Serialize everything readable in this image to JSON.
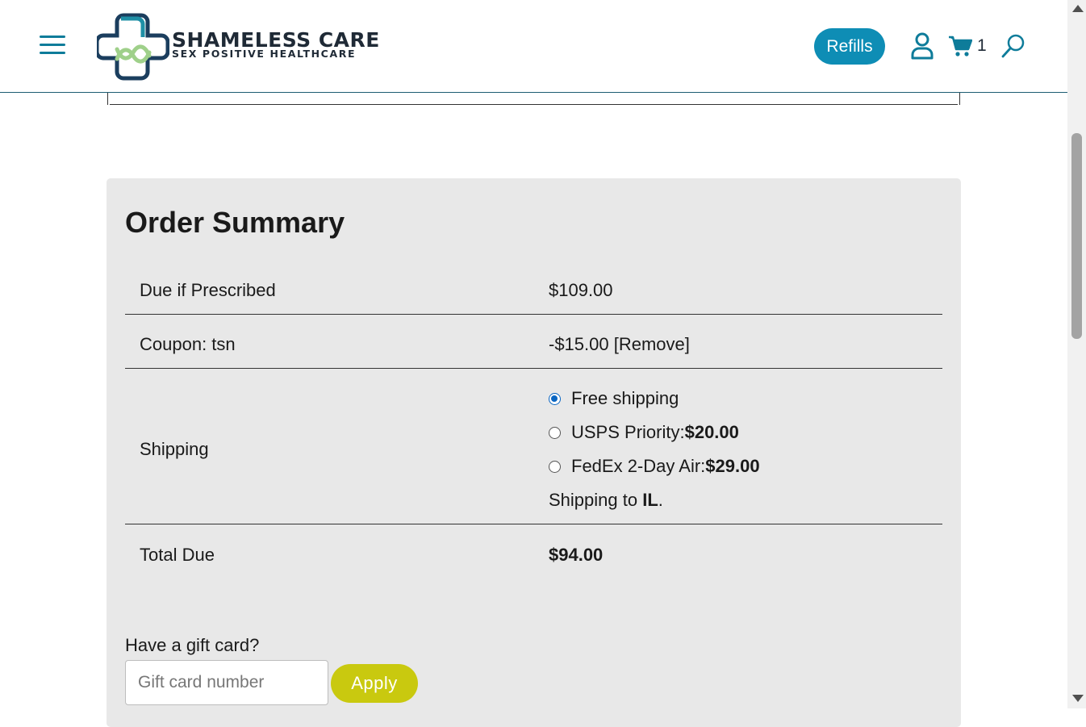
{
  "header": {
    "brand_name": "SHAMELESS CARE",
    "brand_tagline": "SEX POSITIVE HEALTHCARE",
    "refills_label": "Refills",
    "cart_count": "1",
    "menu_icon": "hamburger-menu-icon",
    "user_icon": "user-icon",
    "cart_icon": "cart-icon",
    "search_icon": "search-icon",
    "accent_color": "#0e8db5"
  },
  "order_summary": {
    "title": "Order Summary",
    "rows": {
      "due": {
        "label": "Due if Prescribed",
        "value": "$109.00"
      },
      "coupon": {
        "label": "Coupon: tsn",
        "value": "-$15.00",
        "remove_label": "[Remove]"
      },
      "shipping": {
        "label": "Shipping",
        "options": [
          {
            "name": "Free shipping",
            "price": "",
            "selected": true
          },
          {
            "name": "USPS Priority: ",
            "price": "$20.00",
            "selected": false
          },
          {
            "name": "FedEx 2-Day Air: ",
            "price": "$29.00",
            "selected": false
          }
        ],
        "destination_prefix": "Shipping to ",
        "destination_state": "IL",
        "destination_suffix": "."
      },
      "total": {
        "label": "Total Due",
        "value": "$94.00"
      }
    }
  },
  "gift_card": {
    "label": "Have a gift card?",
    "placeholder": "Gift card number",
    "value": "",
    "apply_label": "Apply",
    "apply_color": "#c9c90f"
  }
}
